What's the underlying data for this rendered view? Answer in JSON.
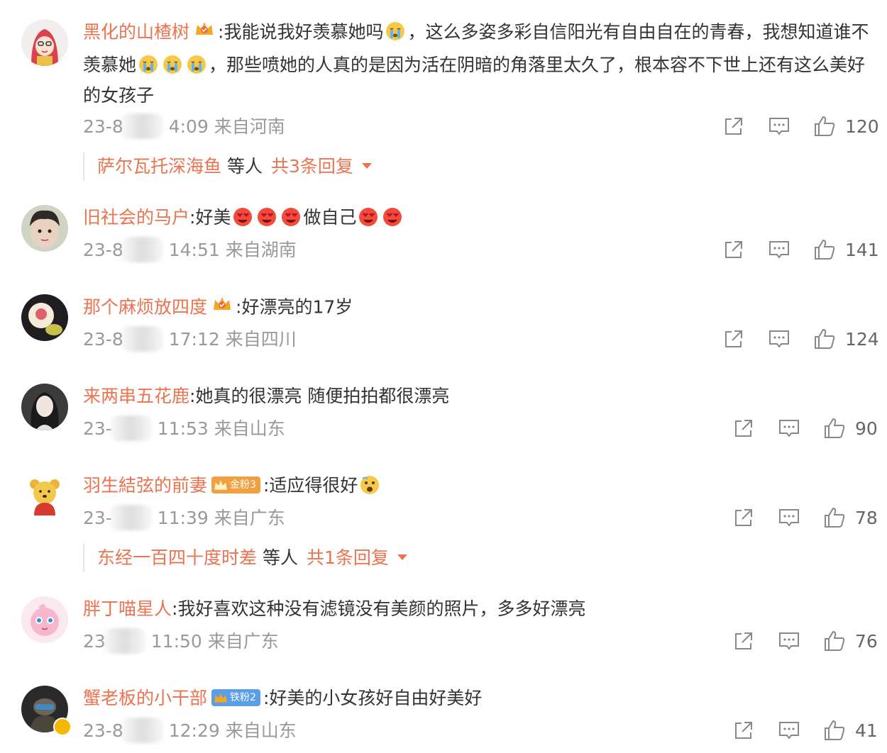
{
  "comments": [
    {
      "username": "黑化的山楂树",
      "text_parts": [
        ":我能说我好羡慕她吗",
        "，这么多姿多彩自信阳光有自由自在的青春，我想知道谁不羡慕她",
        "，那些喷她的人真的是因为活在阴暗的角落里太久了，根本容不下世上还有这么美好的女孩子"
      ],
      "date_prefix": "23-8",
      "time": "4:09",
      "location": "来自河南",
      "likes": "120",
      "reply_user": "萨尔瓦托深海鱼",
      "reply_mid": "等人",
      "reply_count": "共3条回复"
    },
    {
      "username": "旧社会的马户",
      "text_parts": [
        ":好美",
        "做自己"
      ],
      "date_prefix": "23-8",
      "time": "14:51",
      "location": "来自湖南",
      "likes": "141"
    },
    {
      "username": "那个麻烦放四度",
      "text_parts": [
        ":好漂亮的17岁"
      ],
      "date_prefix": "23-8",
      "time": "17:12",
      "location": "来自四川",
      "likes": "124"
    },
    {
      "username": "来两串五花鹿",
      "text_parts": [
        ":她真的很漂亮 随便拍拍都很漂亮"
      ],
      "date_prefix": "23-",
      "time": "11:53",
      "location": "来自山东",
      "likes": "90"
    },
    {
      "username": "羽生結弦的前妻",
      "fan_badge": "金粉3",
      "text_parts": [
        ":适应得很好"
      ],
      "date_prefix": "23-",
      "time": "11:39",
      "location": "来自广东",
      "likes": "78",
      "reply_user": "东经一百四十度时差",
      "reply_mid": "等人",
      "reply_count": "共1条回复"
    },
    {
      "username": "胖丁喵星人",
      "text_parts": [
        ":我好喜欢这种没有滤镜没有美颜的照片，多多好漂亮"
      ],
      "date_prefix": "23",
      "time": "11:50",
      "location": "来自广东",
      "likes": "76"
    },
    {
      "username": "蟹老板的小干部",
      "fan_badge": "铁粉2",
      "text_parts": [
        ":好美的小女孩好自由好美好"
      ],
      "date_prefix": "23-8",
      "time": "12:29",
      "location": "来自山东",
      "likes": "41"
    }
  ],
  "colors": {
    "username": "#eb7350",
    "text": "#333333",
    "meta": "#999999",
    "gold_badge": "#f0a040",
    "iron_badge": "#5b9ee8"
  },
  "icons": [
    "share-icon",
    "comment-icon",
    "like-icon",
    "crown-badge-icon",
    "crying-emoji-icon",
    "heart-eyes-emoji-icon",
    "fearful-emoji-icon"
  ]
}
